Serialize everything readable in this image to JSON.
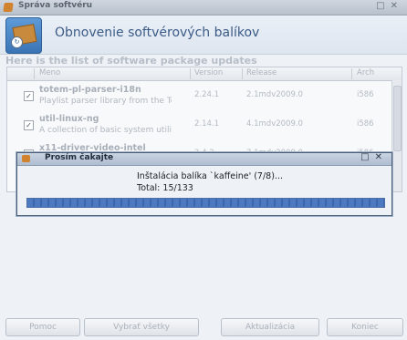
{
  "window": {
    "title": "Správa softvéru"
  },
  "header": {
    "title": "Obnovenie softvérových balíkov"
  },
  "subtitle": "Here is the list of software package updates",
  "table": {
    "columns": [
      "Meno",
      "Version",
      "Release",
      "Arch"
    ],
    "rows": [
      {
        "name": "totem-pl-parser-i18n",
        "desc": "Playlist parser library from the To...",
        "version": "2.24.1",
        "release": "2.1mdv2009.0",
        "arch": "i586",
        "checked": true
      },
      {
        "name": "util-linux-ng",
        "desc": "A collection of basic system utilit...",
        "version": "2.14.1",
        "release": "4.1mdv2009.0",
        "arch": "i586",
        "checked": true
      },
      {
        "name": "x11-driver-video-intel",
        "desc": "",
        "version": "2.4.2",
        "release": "7.1mdv2009.0",
        "arch": "i586",
        "checked": true
      }
    ]
  },
  "buttons": {
    "help": "Pomoc",
    "select_all": "Vybrať všetky",
    "update": "Aktualizácia",
    "quit": "Koniec"
  },
  "dialog": {
    "title": "Prosím čakajte",
    "message": "Inštalácia balíka `kaffeine' (7/8)...",
    "total": "Total: 15/133",
    "progress": 1.0
  },
  "colors": {
    "accent": "#3b5b86",
    "progress": "#4d79c0"
  }
}
